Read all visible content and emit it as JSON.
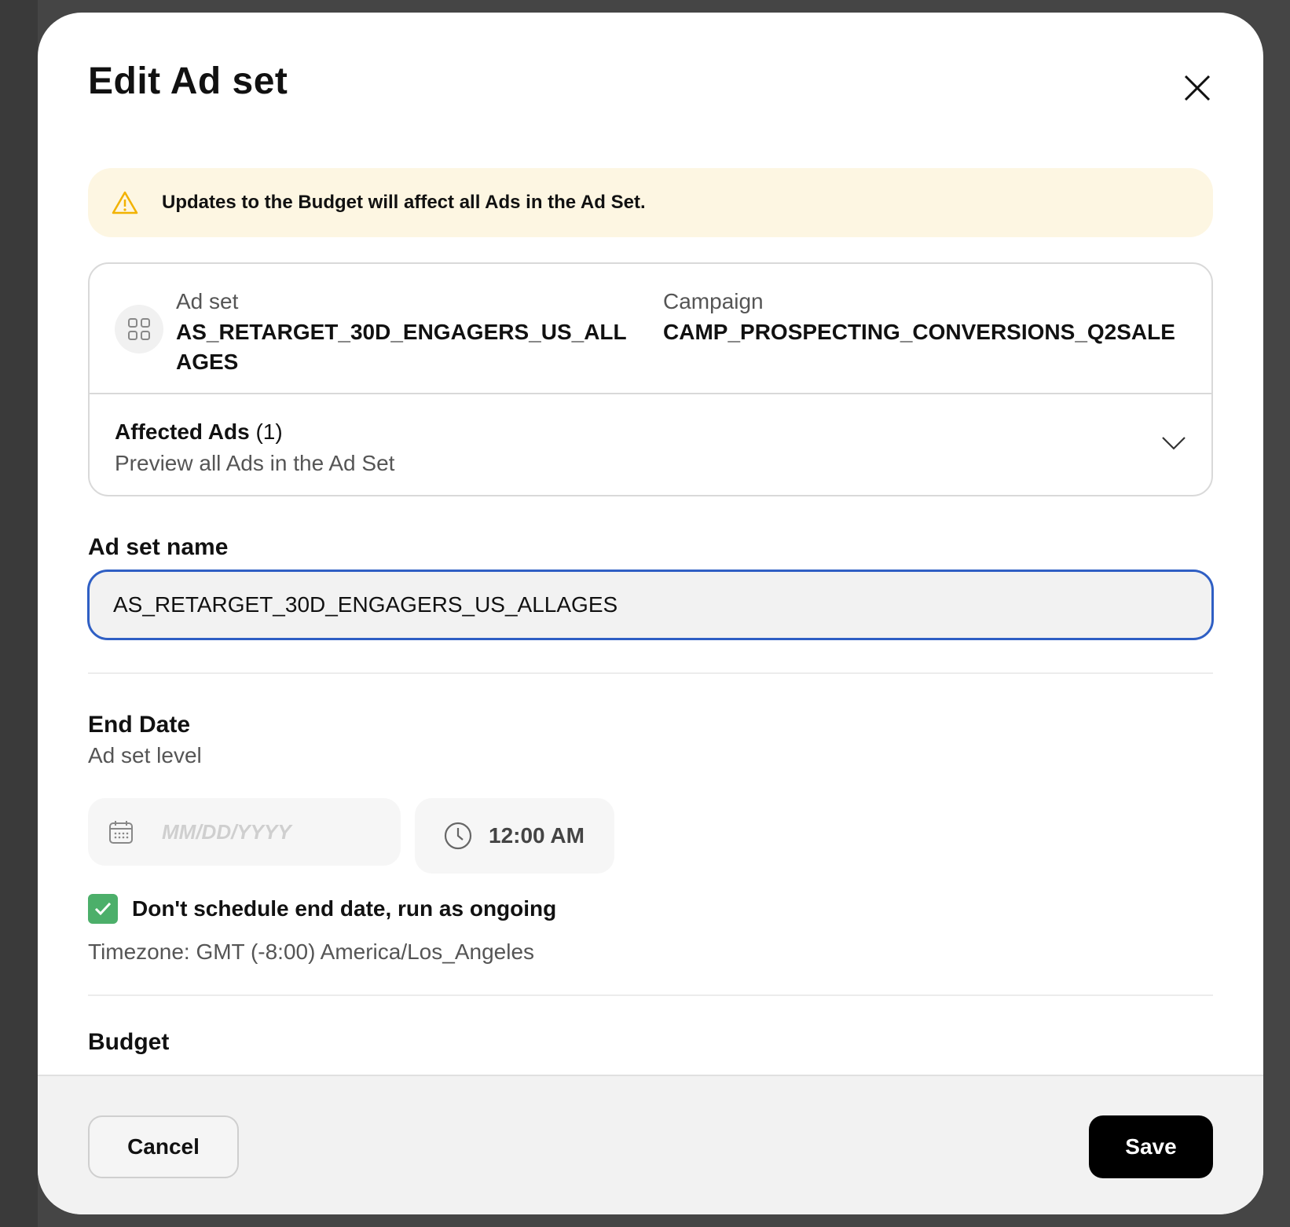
{
  "modal": {
    "title": "Edit Ad set"
  },
  "banner": {
    "text": "Updates to the Budget will affect all Ads in the Ad Set.",
    "icon": "warning-icon",
    "color": "#f2b200"
  },
  "info": {
    "adset_label": "Ad set",
    "adset_value": "AS_RETARGET_30D_ENGAGERS_US_ALLAGES",
    "campaign_label": "Campaign",
    "campaign_value": "CAMP_PROSPECTING_CONVERSIONS_Q2SALE",
    "affected_title": "Affected Ads",
    "affected_count": "(1)",
    "affected_sub": "Preview all Ads in the Ad Set"
  },
  "name_field": {
    "label": "Ad set name",
    "value": "AS_RETARGET_30D_ENGAGERS_US_ALLAGES"
  },
  "end_date": {
    "title": "End Date",
    "subtitle": "Ad set level",
    "date_placeholder": "MM/DD/YYYY",
    "time_value": "12:00 AM",
    "ongoing_label": "Don't schedule end date, run as ongoing",
    "ongoing_checked": true,
    "timezone": "Timezone: GMT (-8:00) America/Los_Angeles"
  },
  "budget": {
    "title": "Budget"
  },
  "footer": {
    "cancel_label": "Cancel",
    "save_label": "Save"
  },
  "colors": {
    "focus_border": "#2f5fc4",
    "checkbox": "#4caf6a",
    "banner_bg": "#fdf6e2"
  }
}
